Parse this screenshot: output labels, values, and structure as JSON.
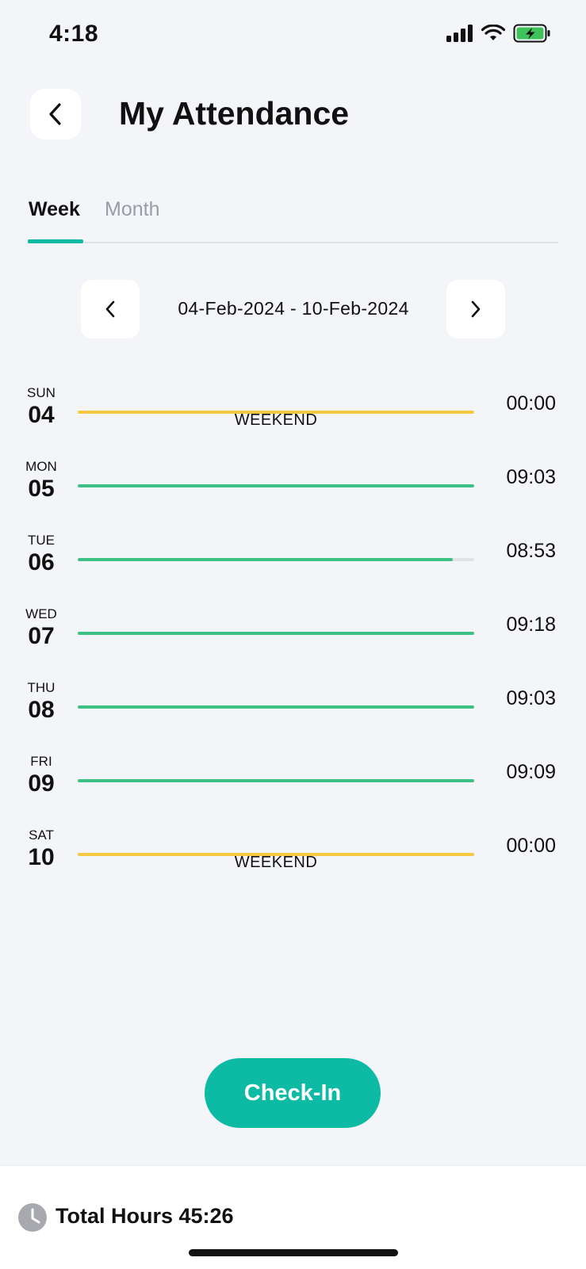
{
  "status_bar": {
    "time": "4:18"
  },
  "header": {
    "title": "My Attendance"
  },
  "tabs": [
    {
      "label": "Week",
      "active": true
    },
    {
      "label": "Month",
      "active": false
    }
  ],
  "week_nav": {
    "date_range": "04-Feb-2024 - 10-Feb-2024"
  },
  "colors": {
    "accent": "#12B9A3",
    "worked": "#3CC083",
    "weekend": "#F5C843",
    "track": "#E2E3E8"
  },
  "days": [
    {
      "name": "SUN",
      "date": "04",
      "hours": "00:00",
      "status": "weekend",
      "label": "WEEKEND",
      "progress": 1.0
    },
    {
      "name": "MON",
      "date": "05",
      "hours": "09:03",
      "status": "worked",
      "label": "",
      "progress": 1.0
    },
    {
      "name": "TUE",
      "date": "06",
      "hours": "08:53",
      "status": "worked",
      "label": "",
      "progress": 0.945
    },
    {
      "name": "WED",
      "date": "07",
      "hours": "09:18",
      "status": "worked",
      "label": "",
      "progress": 1.0
    },
    {
      "name": "THU",
      "date": "08",
      "hours": "09:03",
      "status": "worked",
      "label": "",
      "progress": 1.0
    },
    {
      "name": "FRI",
      "date": "09",
      "hours": "09:09",
      "status": "worked",
      "label": "",
      "progress": 1.0
    },
    {
      "name": "SAT",
      "date": "10",
      "hours": "00:00",
      "status": "weekend",
      "label": "WEEKEND",
      "progress": 1.0
    }
  ],
  "actions": {
    "check_in_label": "Check-In"
  },
  "footer": {
    "total_hours_label": "Total Hours 45:26"
  },
  "icons": {
    "back": "chevron-left-icon",
    "prev": "chevron-left-icon",
    "next": "chevron-right-icon",
    "clock": "clock-icon",
    "signal": "signal-icon",
    "wifi": "wifi-icon",
    "battery": "battery-charging-icon"
  }
}
